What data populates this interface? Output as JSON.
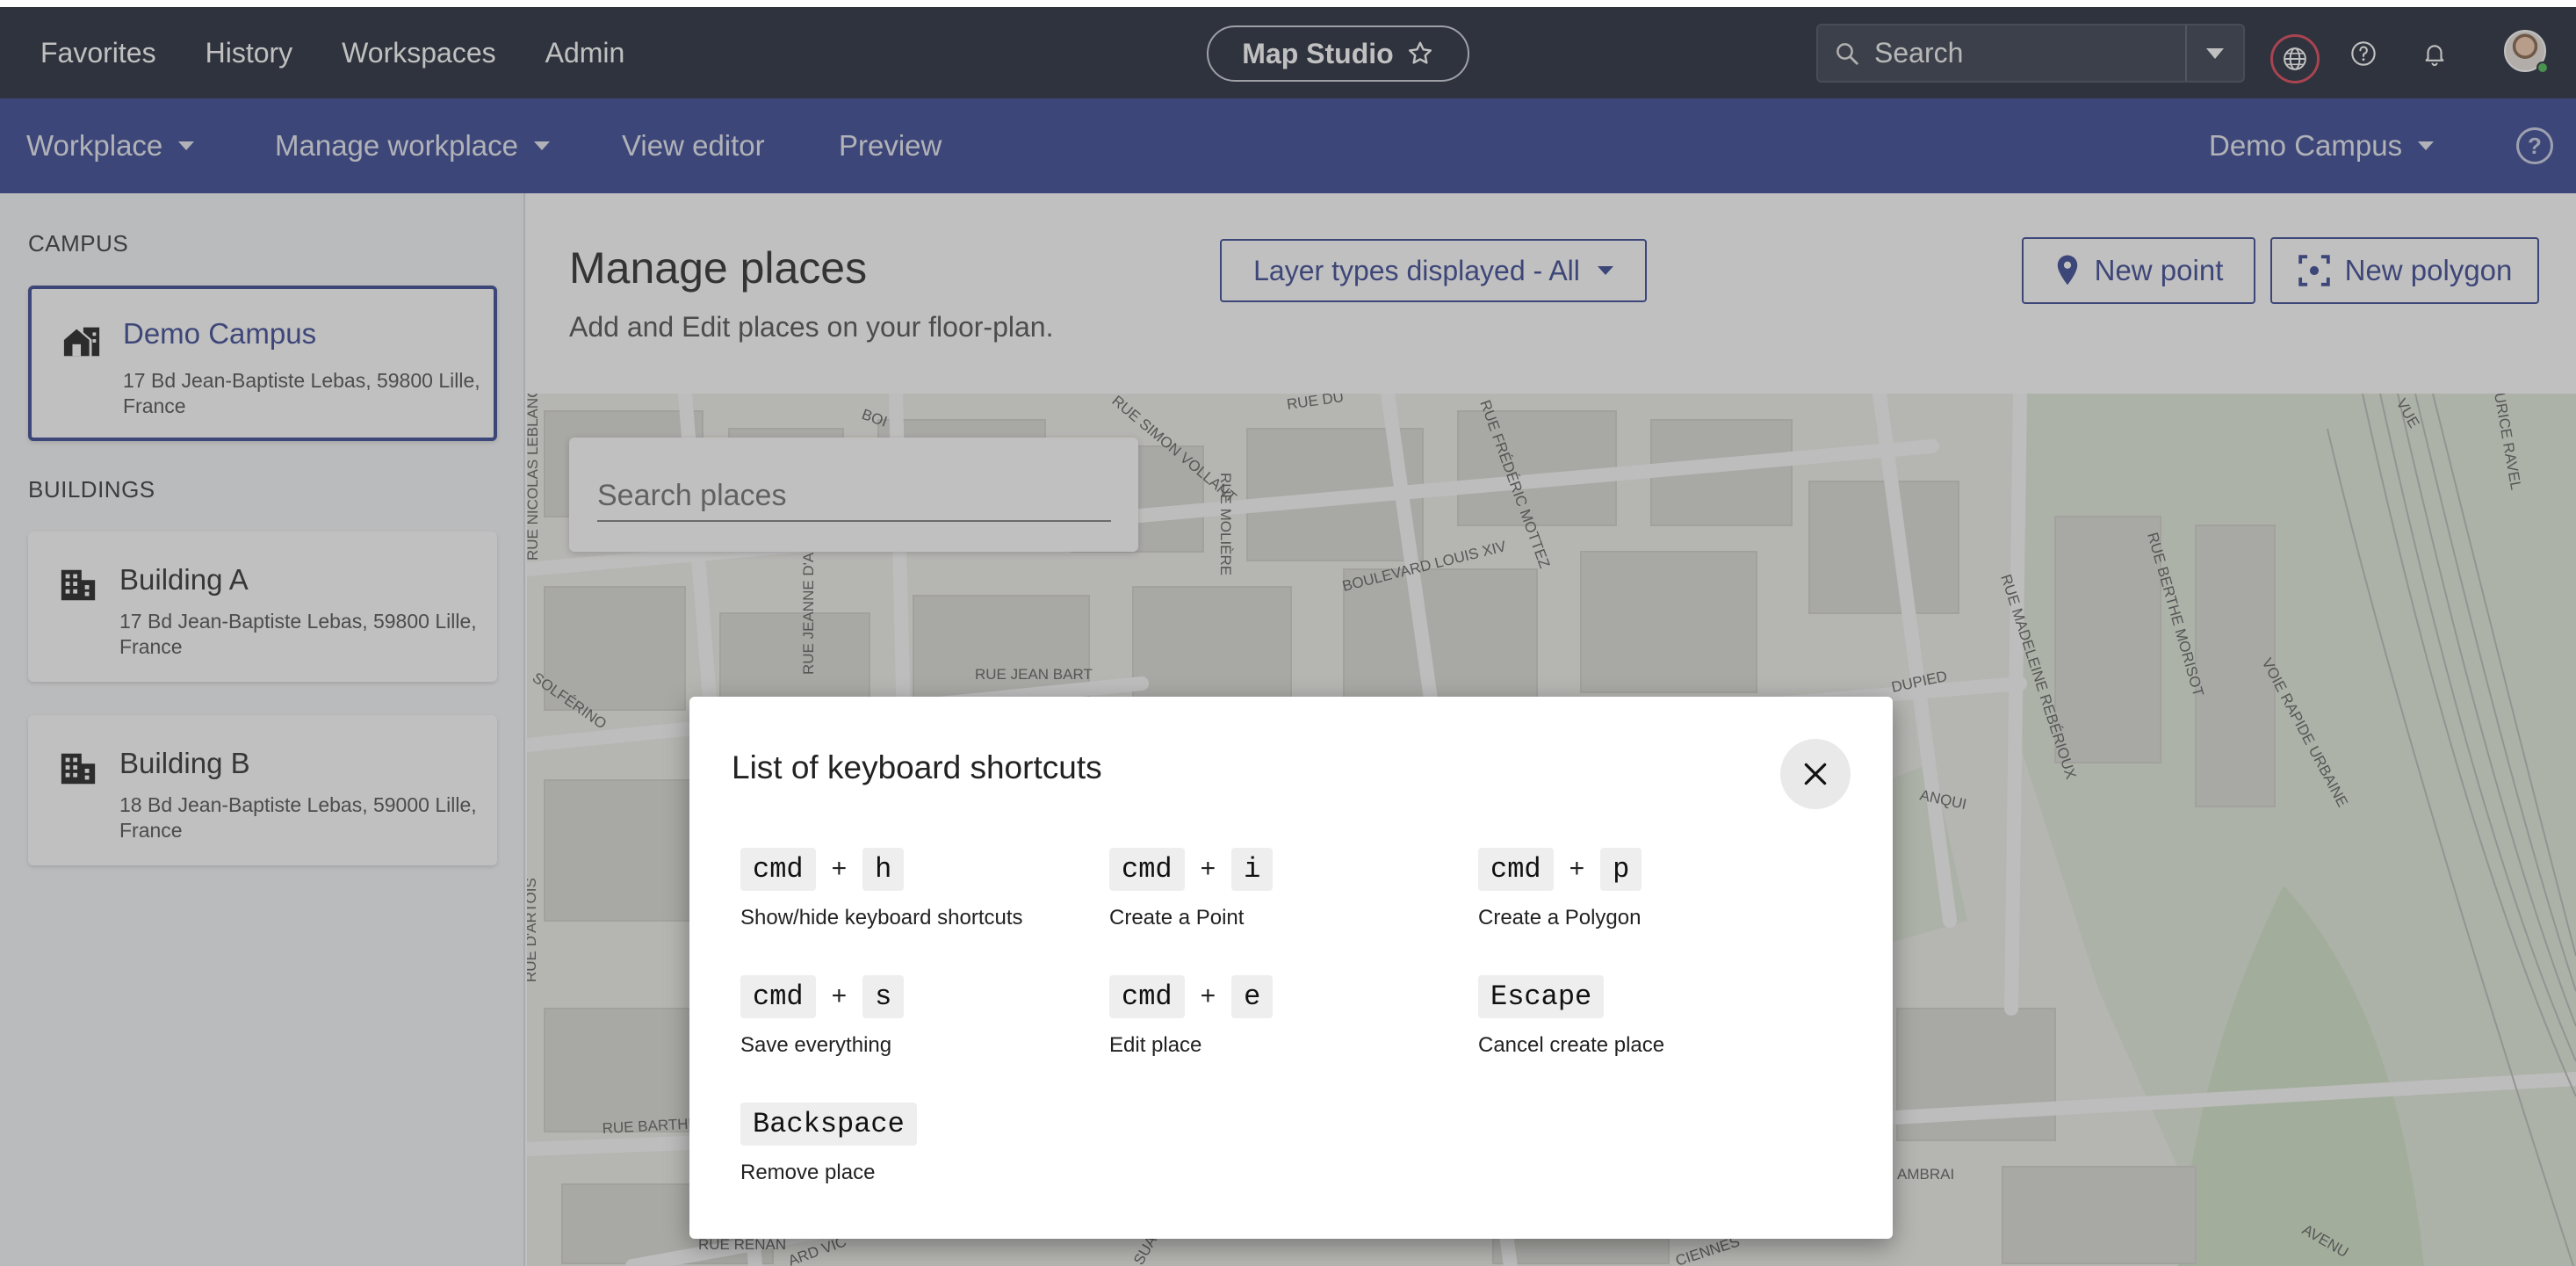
{
  "topbar": {
    "nav": [
      "Favorites",
      "History",
      "Workspaces",
      "Admin"
    ],
    "brand": "Map Studio",
    "search_placeholder": "Search"
  },
  "subbar": {
    "workplace": "Workplace",
    "manage_workplace": "Manage workplace",
    "view_editor": "View editor",
    "preview": "Preview",
    "campus_select": "Demo Campus"
  },
  "sidebar": {
    "campus_title": "CAMPUS",
    "campus": {
      "name": "Demo Campus",
      "address": "17 Bd Jean-Baptiste Lebas, 59800 Lille, France"
    },
    "buildings_title": "BUILDINGS",
    "buildings": [
      {
        "name": "Building A",
        "address": "17 Bd Jean-Baptiste Lebas, 59800 Lille, France"
      },
      {
        "name": "Building B",
        "address": "18 Bd Jean-Baptiste Lebas, 59000 Lille, France"
      }
    ]
  },
  "main": {
    "title": "Manage places",
    "subtitle": "Add and Edit places on your floor-plan.",
    "layer_filter": "Layer types displayed - All",
    "new_point": "New point",
    "new_polygon": "New polygon",
    "search_places_placeholder": "Search places"
  },
  "map": {
    "streets": [
      "RUE DU",
      "RUE SIMON VOLLANT",
      "BOI",
      "RUE NICOLAS LEBLANC",
      "RUE MOLIÈRE",
      "RUE FRÉDÉRIC MOTTEZ",
      "BOULEVARD LOUIS XIV",
      "RUE JEANNE D'ARC",
      "RUE JEAN BART",
      "SOLFÉRINO",
      "RUE MADELEINE REBÉRIOUX",
      "RUE BERTHE MORISOT",
      "VOIE RAPIDE URBAINE",
      "URICE RAVEL",
      "VUE",
      "DUPIED",
      "ANQUI",
      "RUE D'ARTOIS",
      "RUE BARTHÉ",
      "RUE RENAN",
      "ARD VIC",
      "AMBRAI",
      "AVENU",
      "CIENNES",
      "SUAR"
    ]
  },
  "modal": {
    "title": "List of keyboard shortcuts",
    "shortcuts": [
      {
        "keys": [
          "cmd",
          "h"
        ],
        "desc": "Show/hide keyboard shortcuts"
      },
      {
        "keys": [
          "cmd",
          "i"
        ],
        "desc": "Create a Point"
      },
      {
        "keys": [
          "cmd",
          "p"
        ],
        "desc": "Create a Polygon"
      },
      {
        "keys": [
          "cmd",
          "s"
        ],
        "desc": "Save everything"
      },
      {
        "keys": [
          "cmd",
          "e"
        ],
        "desc": "Edit place"
      },
      {
        "keys": [
          "Escape"
        ],
        "desc": "Cancel create place"
      },
      {
        "keys": [
          "Backspace"
        ],
        "desc": "Remove place"
      }
    ],
    "plus": "+"
  },
  "colors": {
    "topbar": "#151c2c",
    "subbar": "#2d3a8c",
    "accent": "#2d3a8c",
    "alert_ring": "#d8374b",
    "online": "#3fb54a"
  },
  "icons": [
    "star-icon",
    "search-icon",
    "chevron-down-icon",
    "globe-icon",
    "help-icon",
    "bell-icon",
    "campus-icon",
    "building-icon",
    "map-pin-icon",
    "polygon-icon",
    "close-icon"
  ]
}
